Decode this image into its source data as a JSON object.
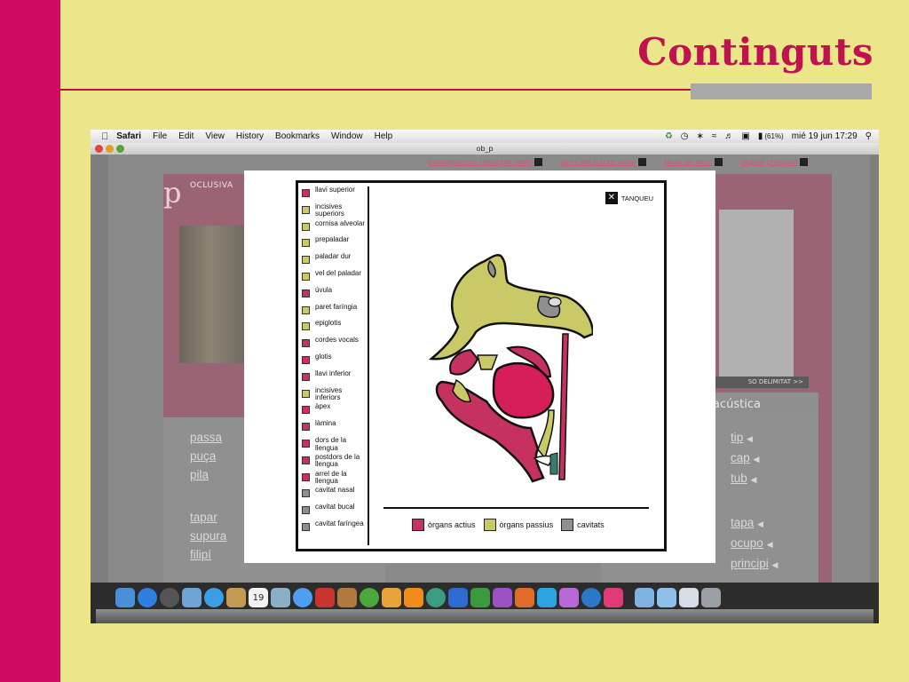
{
  "slide": {
    "title": "Continguts"
  },
  "colors": {
    "slide_background": "#ebe68a",
    "left_bar": "#d00b62",
    "title": "#c0124e",
    "organ_active": "#c5325f",
    "organ_passive": "#c9c967",
    "cavity": "#8f8f8f"
  },
  "mac_menubar": {
    "apple_icon": "apple-icon",
    "app_name": "Safari",
    "menus": [
      "File",
      "Edit",
      "View",
      "History",
      "Bookmarks",
      "Window",
      "Help"
    ],
    "status_icons": [
      "sync-icon",
      "time-machine-icon",
      "bluetooth-icon",
      "wifi-icon",
      "volume-icon",
      "display-icon",
      "battery-icon"
    ],
    "battery": "(61%)",
    "clock": "mié 19 jun  17:29",
    "spotlight_icon": "search-icon"
  },
  "browser_window": {
    "title": "ob_p"
  },
  "site": {
    "top_nav": [
      "palatogrames i imatges reals",
      "parts del tracte vocal",
      "taula de sons",
      "pàgina principal"
    ],
    "section_letter": "p",
    "section_name": "OCLUSIVA",
    "so_delimitat": "SO DELIMITAT >>",
    "acoustics_tab": "acústica",
    "left_words": [
      "passa",
      "puça",
      "pila",
      "tapar",
      "supura",
      "filipí"
    ],
    "right_words": [
      "tip",
      "cap",
      "tub",
      "tapa",
      "ocupo",
      "principi"
    ]
  },
  "modal": {
    "close_label": "TANQUEU",
    "legend_items": [
      {
        "label": "llavi superior",
        "type": "active"
      },
      {
        "label": "incisives superiors",
        "type": "passive"
      },
      {
        "label": "cornisa alveolar",
        "type": "passive"
      },
      {
        "label": "prepaladar",
        "type": "passive"
      },
      {
        "label": "paladar dur",
        "type": "passive"
      },
      {
        "label": "vel del paladar",
        "type": "passive"
      },
      {
        "label": "úvula",
        "type": "active"
      },
      {
        "label": "paret faríngia",
        "type": "passive"
      },
      {
        "label": "epiglotis",
        "type": "passive"
      },
      {
        "label": "cordes vocals",
        "type": "active"
      },
      {
        "label": "glotis",
        "type": "active"
      },
      {
        "label": "llavi inferior",
        "type": "active"
      },
      {
        "label": "incisives inferiors",
        "type": "passive"
      },
      {
        "label": "àpex",
        "type": "active"
      },
      {
        "label": "làmina",
        "type": "active"
      },
      {
        "label": "dors de la llengua",
        "type": "active"
      },
      {
        "label": "postdors de la llengua",
        "type": "active"
      },
      {
        "label": "arrel de la llengua",
        "type": "active"
      },
      {
        "label": "cavitat nasal",
        "type": "cavity"
      },
      {
        "label": "cavitat bucal",
        "type": "cavity"
      },
      {
        "label": "cavitat faríngea",
        "type": "cavity"
      }
    ],
    "bottom_legend": {
      "active": "òrgans actius",
      "passive": "òrgans passius",
      "cavities": "cavitats"
    }
  },
  "dock": {
    "apps": [
      "finder-icon",
      "app-store-icon",
      "dashboard-icon",
      "preview-icon",
      "safari-icon",
      "contacts-icon",
      "calendar-icon",
      "iphoto-icon",
      "itunes-icon",
      "photo-booth-icon",
      "image-capture-icon",
      "spotify-icon",
      "garageband-icon",
      "vlc-icon",
      "time-machine-icon",
      "word-icon",
      "excel-icon",
      "messenger-icon",
      "powerpoint-icon",
      "skype-icon",
      "folder-icon",
      "mendeley-icon",
      "indesign-icon",
      "documents-icon",
      "applications-icon",
      "downloads-icon",
      "trash-icon"
    ],
    "calendar_day": "19"
  }
}
